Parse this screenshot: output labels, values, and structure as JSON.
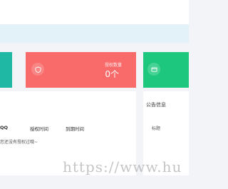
{
  "cards": [
    {
      "label": "",
      "value": "",
      "color": "#1fb8a5",
      "icon": "chart-icon"
    },
    {
      "label": "授权数量",
      "value": "0个",
      "color": "#f96b6b",
      "icon": "shield-icon"
    },
    {
      "label": "",
      "value": "",
      "color": "#1ec77e",
      "icon": "card-icon"
    }
  ],
  "table": {
    "columns": [
      "QQ",
      "授权时间",
      "到期时间"
    ],
    "rows_text": "您还没有授权过哦~"
  },
  "notice": {
    "title": "公告信息",
    "column": "标题"
  },
  "watermark": "https://www.hu"
}
